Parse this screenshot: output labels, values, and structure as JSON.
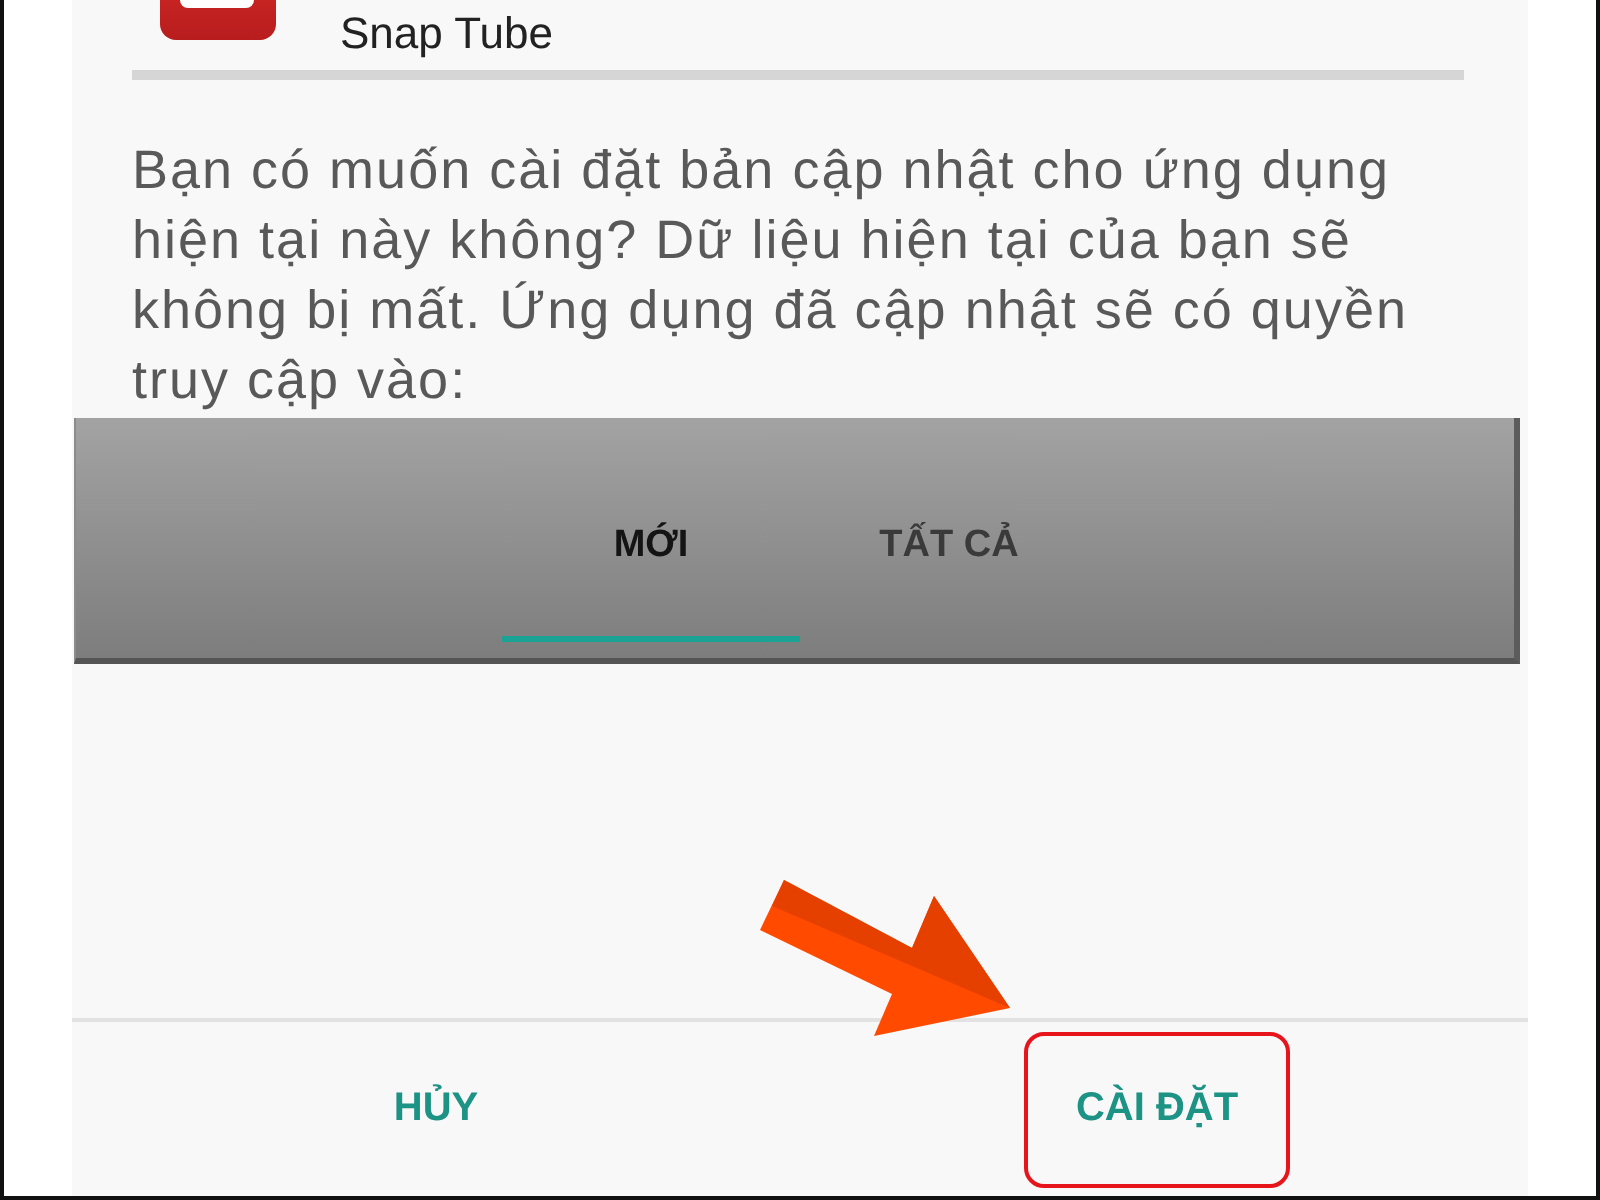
{
  "app": {
    "title": "Snap Tube"
  },
  "message": "Bạn có muốn cài đặt bản cập nhật cho ứng dụng hiện tại này không? Dữ liệu hiện tại của bạn sẽ không bị mất. Ứng dụng đã cập nhật sẽ có quyền truy cập vào:",
  "tabs": [
    {
      "label": "MỚI",
      "selected": true
    },
    {
      "label": "TẤT CẢ",
      "selected": false
    }
  ],
  "buttons": [
    {
      "label": "HỦY",
      "highlighted": false
    },
    {
      "label": "CÀI ĐẶT",
      "highlighted": true
    }
  ]
}
